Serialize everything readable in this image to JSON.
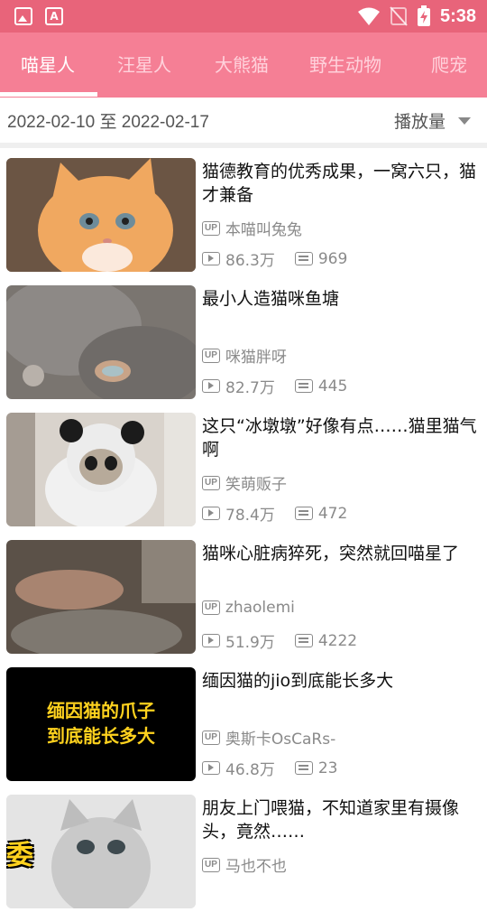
{
  "status_bar": {
    "time": "5:38",
    "icons": [
      "image-icon",
      "font-icon",
      "wifi-icon",
      "no-sim-icon",
      "battery-charging-icon"
    ]
  },
  "tabs": [
    {
      "label": "喵星人",
      "active": true
    },
    {
      "label": "汪星人",
      "active": false
    },
    {
      "label": "大熊猫",
      "active": false
    },
    {
      "label": "野生动物",
      "active": false
    },
    {
      "label": "爬宠",
      "active": false
    }
  ],
  "filter": {
    "date_range": "2022-02-10 至 2022-02-17",
    "sort_label": "播放量"
  },
  "badge_label": "UP",
  "videos": [
    {
      "title": "猫德教育的优秀成果，一窝六只，猫才兼备",
      "uploader": "本喵叫兔兔",
      "plays": "86.3万",
      "danmaku": "969"
    },
    {
      "title": "最小人造猫咪鱼塘",
      "uploader": "咪猫胖呀",
      "plays": "82.7万",
      "danmaku": "445"
    },
    {
      "title": "这只“冰墩墩”好像有点……猫里猫气啊",
      "uploader": "笑萌贩子",
      "plays": "78.4万",
      "danmaku": "472"
    },
    {
      "title": "猫咪心脏病猝死，突然就回喵星了",
      "uploader": "zhaolemi",
      "plays": "51.9万",
      "danmaku": "4222"
    },
    {
      "title": "缅因猫的jio到底能长多大",
      "uploader": "奥斯卡OsCaRs-",
      "plays": "46.8万",
      "danmaku": "23",
      "thumb_text": "缅因猫的爪子\n到底能长多大"
    },
    {
      "title": "朋友上门喂猫，不知道家里有摄像头，竟然……",
      "uploader": "马也不也",
      "plays": "",
      "danmaku": "",
      "thumb_text": "委  屈"
    }
  ]
}
